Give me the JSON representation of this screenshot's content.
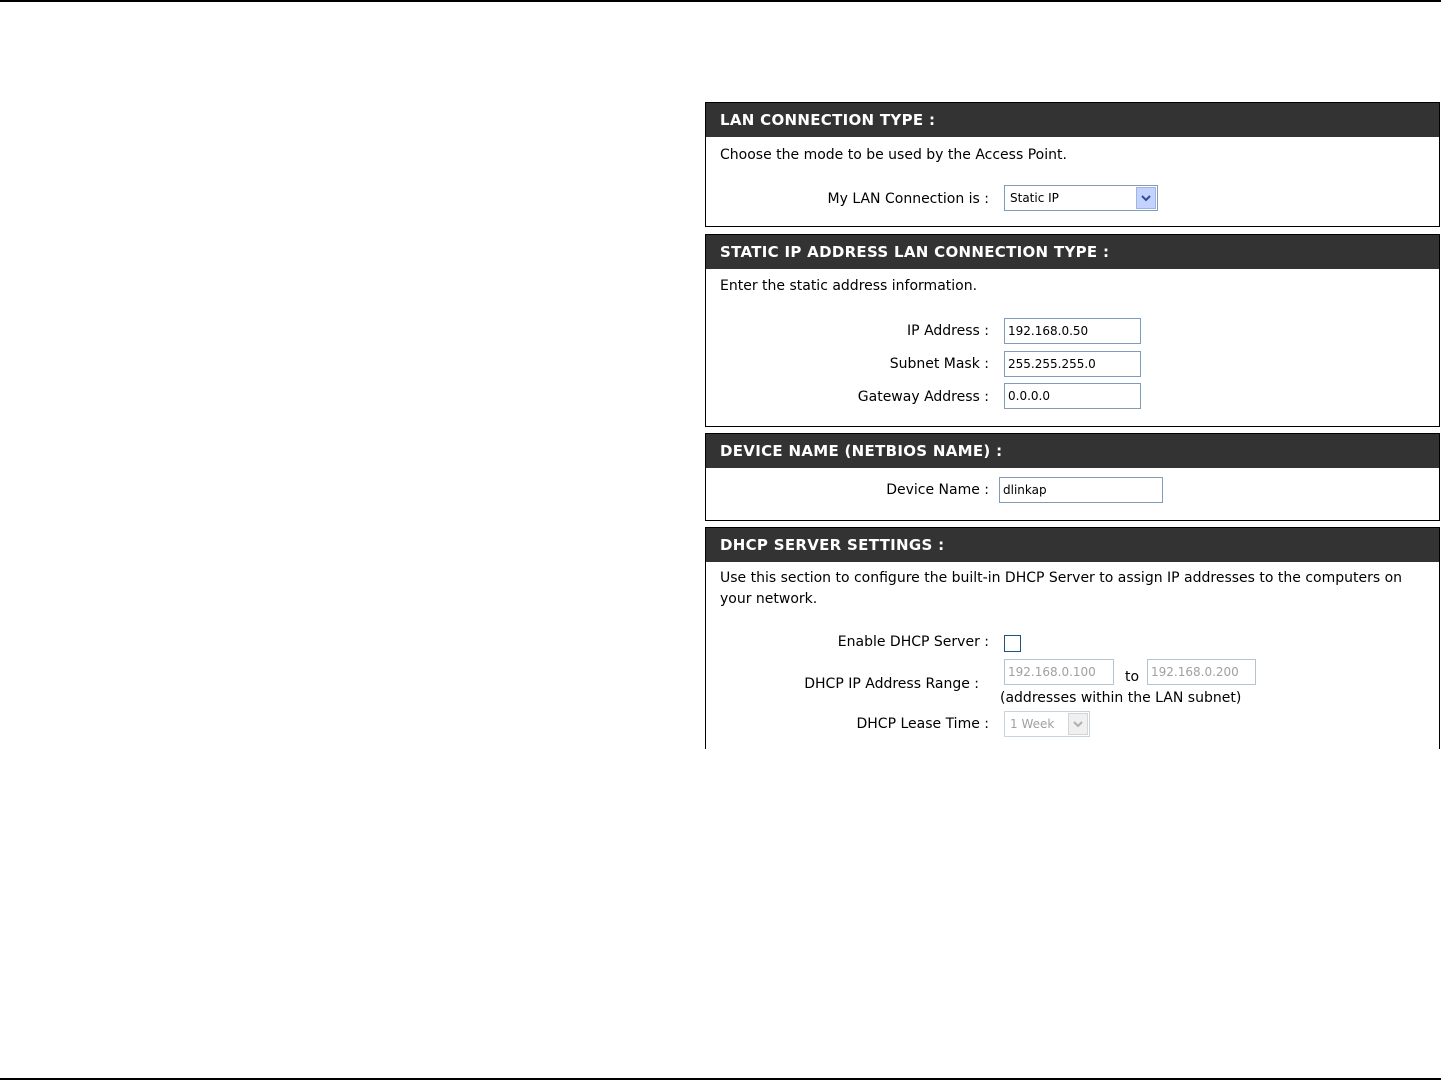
{
  "lan_connection": {
    "title": "LAN CONNECTION TYPE :",
    "description": "Choose the mode to be used by the Access Point.",
    "mode_label": "My LAN Connection is :",
    "mode_value": "Static IP"
  },
  "static_ip": {
    "title": "STATIC IP ADDRESS LAN CONNECTION TYPE :",
    "description": "Enter the static address information.",
    "ip_label": "IP Address :",
    "ip_value": "192.168.0.50",
    "subnet_label": "Subnet Mask :",
    "subnet_value": "255.255.255.0",
    "gateway_label": "Gateway Address :",
    "gateway_value": "0.0.0.0"
  },
  "device_name": {
    "title": "DEVICE NAME (NETBIOS NAME) :",
    "label": "Device Name :",
    "value": "dlinkap"
  },
  "dhcp": {
    "title": "DHCP SERVER SETTINGS :",
    "description": "Use this section to configure the built-in DHCP Server to assign IP addresses to the computers on your network.",
    "enable_label": "Enable DHCP Server :",
    "enable_checked": false,
    "range_label": "DHCP IP Address Range :",
    "range_start": "192.168.0.100",
    "range_to": "to",
    "range_end": "192.168.0.200",
    "range_note": "(addresses within the LAN subnet)",
    "lease_label": "DHCP Lease Time :",
    "lease_value": "1 Week"
  }
}
